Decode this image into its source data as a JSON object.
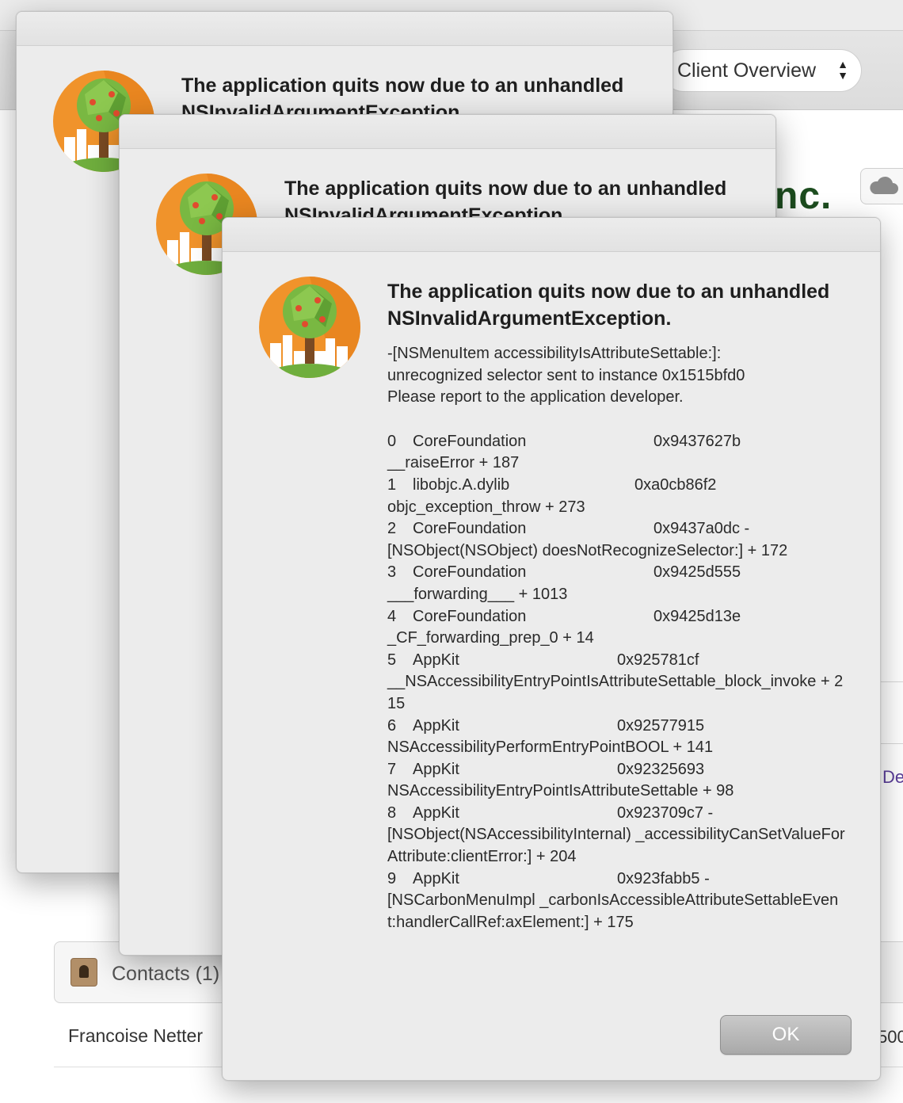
{
  "background_window": {
    "client_select_value": "Client Overview",
    "company_name_fragment": "nc.",
    "side_link_fragment": "De",
    "contacts_label": "Contacts (1)",
    "contact_name": "Francoise Netter",
    "row_value_fragment": "500"
  },
  "alert": {
    "title": "The application quits now due to an unhandled NSInvalidArgumentException.",
    "selector_line": "-[NSMenuItem accessibilityIsAttributeSettable:]:",
    "selector_detail": "unrecognized selector sent to instance 0x1515bfd0",
    "report_line": "Please report to the application developer.",
    "stack_trace": [
      {
        "index": "0",
        "library": "CoreFoundation",
        "address": "0x9437627b",
        "symbol": "__raiseError + 187"
      },
      {
        "index": "1",
        "library": "libobjc.A.dylib",
        "address": "0xa0cb86f2",
        "symbol": "objc_exception_throw + 273"
      },
      {
        "index": "2",
        "library": "CoreFoundation",
        "address": "0x9437a0dc -",
        "symbol": "[NSObject(NSObject) doesNotRecognizeSelector:] + 172"
      },
      {
        "index": "3",
        "library": "CoreFoundation",
        "address": "0x9425d555",
        "symbol": "___forwarding___ + 1013"
      },
      {
        "index": "4",
        "library": "CoreFoundation",
        "address": "0x9425d13e",
        "symbol": "_CF_forwarding_prep_0 + 14"
      },
      {
        "index": "5",
        "library": "AppKit",
        "address": "0x925781cf",
        "symbol": "__NSAccessibilityEntryPointIsAttributeSettable_block_invoke + 215"
      },
      {
        "index": "6",
        "library": "AppKit",
        "address": "0x92577915",
        "symbol": "NSAccessibilityPerformEntryPointBOOL + 141"
      },
      {
        "index": "7",
        "library": "AppKit",
        "address": "0x92325693",
        "symbol": "NSAccessibilityEntryPointIsAttributeSettable + 98"
      },
      {
        "index": "8",
        "library": "AppKit",
        "address": "0x923709c7 -",
        "symbol": "[NSObject(NSAccessibilityInternal) _accessibilityCanSetValueForAttribute:clientError:] + 204"
      },
      {
        "index": "9",
        "library": "AppKit",
        "address": "0x923fabb5 -",
        "symbol": "[NSCarbonMenuImpl _carbonIsAccessibleAttributeSettableEvent:handlerCallRef:axElement:] + 175"
      }
    ],
    "ok_label": "OK"
  }
}
